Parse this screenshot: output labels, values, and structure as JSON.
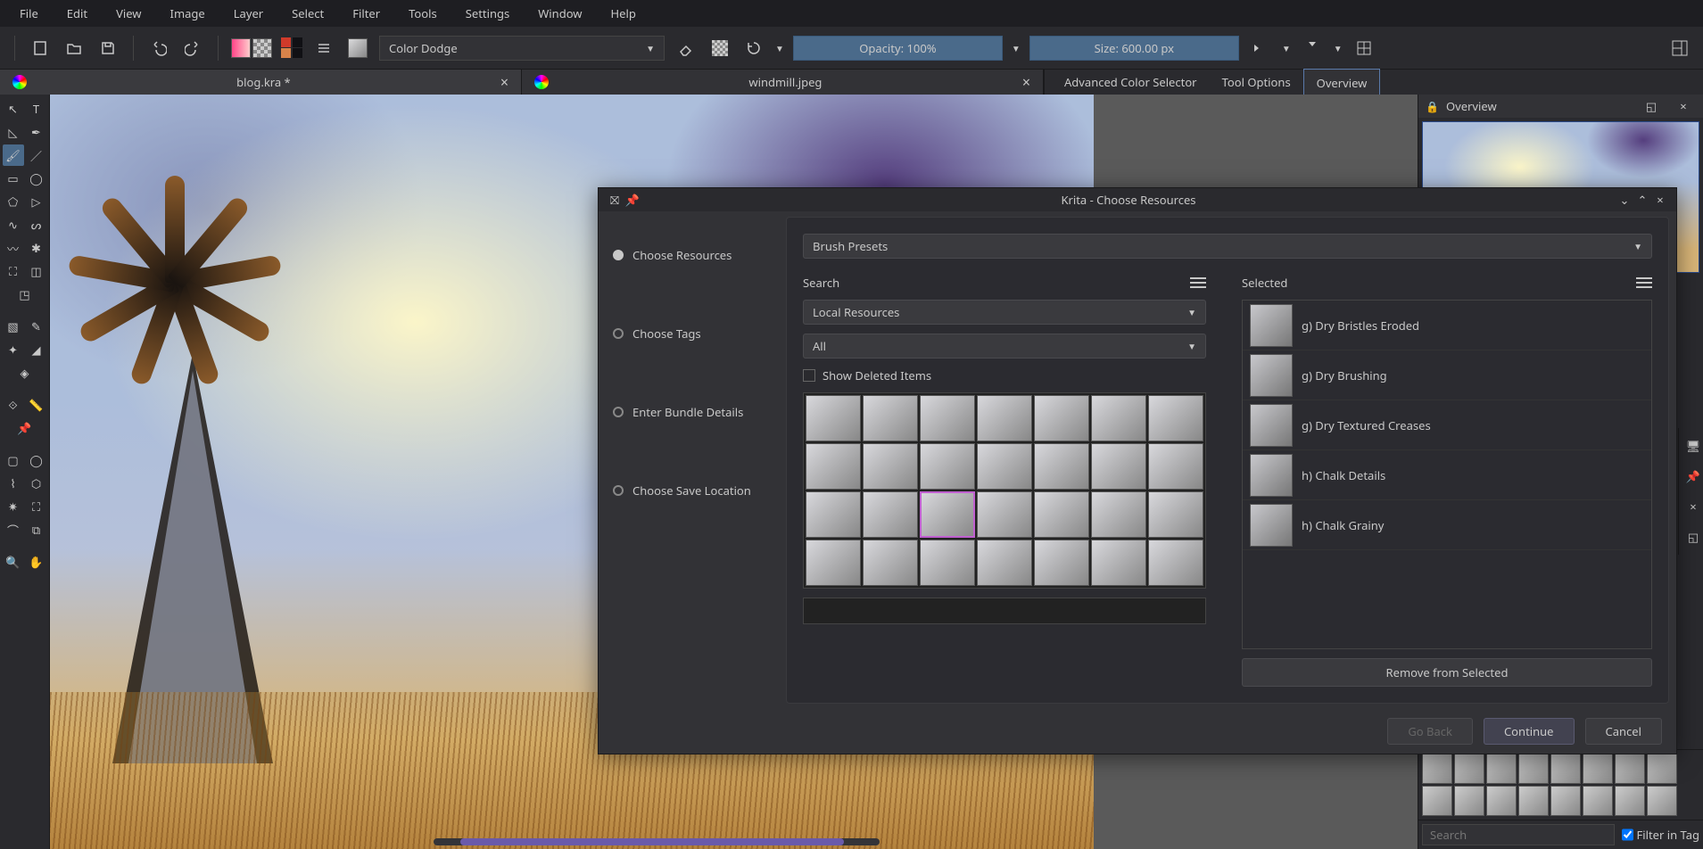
{
  "menu": {
    "items": [
      "File",
      "Edit",
      "View",
      "Image",
      "Layer",
      "Select",
      "Filter",
      "Tools",
      "Settings",
      "Window",
      "Help"
    ]
  },
  "toolbar": {
    "blend_mode": "Color Dodge",
    "opacity_label": "Opacity: 100%",
    "size_label": "Size: 600.00 px"
  },
  "tabs": {
    "documents": [
      {
        "title": "blog.kra *",
        "active": true
      },
      {
        "title": "windmill.jpeg",
        "active": false
      }
    ],
    "panels": [
      {
        "label": "Advanced Color Selector",
        "active": false
      },
      {
        "label": "Tool Options",
        "active": false
      },
      {
        "label": "Overview",
        "active": true
      }
    ]
  },
  "overview_panel": {
    "title": "Overview"
  },
  "brush_search": {
    "placeholder": "Search",
    "filter_label": "Filter in Tag",
    "filter_checked": true
  },
  "dialog": {
    "title": "Krita - Choose Resources",
    "resource_type": "Brush Presets",
    "steps": {
      "choose_resources": "Choose Resources",
      "choose_tags": "Choose Tags",
      "enter_bundle": "Enter Bundle Details",
      "choose_save": "Choose Save Location"
    },
    "search_label": "Search",
    "source": "Local Resources",
    "tag_filter": "All",
    "deleted_label": "Show Deleted Items",
    "selected_label": "Selected",
    "remove_label": "Remove from Selected",
    "go_back": "Go Back",
    "continue": "Continue",
    "cancel": "Cancel",
    "selected_items": [
      "g) Dry Bristles Eroded",
      "g) Dry Brushing",
      "g) Dry Textured Creases",
      "h) Chalk Details",
      "h) Chalk Grainy"
    ]
  }
}
